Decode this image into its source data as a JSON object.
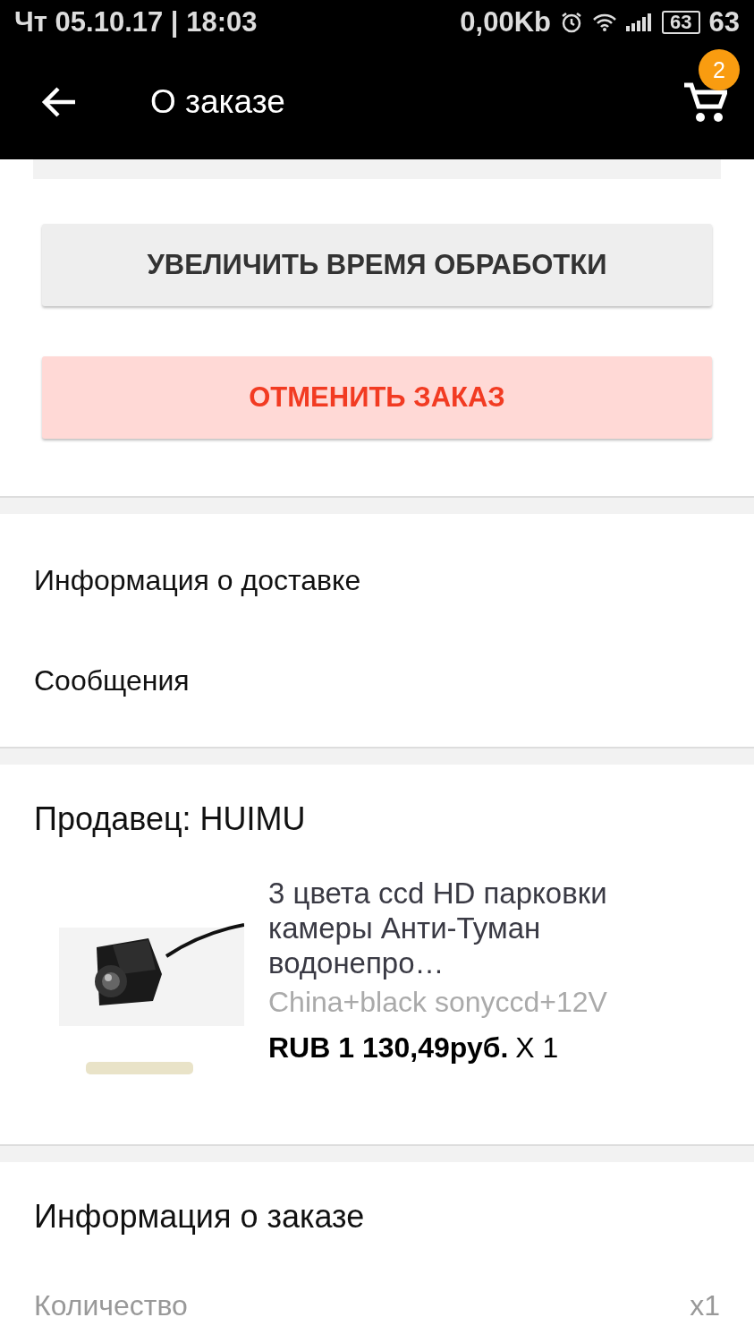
{
  "status_bar": {
    "datetime": "Чт 05.10.17 | 18:03",
    "network_speed": "0,00Kb",
    "battery_icon_text": "63",
    "battery": "63"
  },
  "app_bar": {
    "title": "О заказе",
    "cart_badge": "2"
  },
  "buttons": [
    {
      "label": "УВЕЛИЧИТЬ ВРЕМЯ ОБРАБОТКИ",
      "kind": "neutral"
    },
    {
      "label": "ОТМЕНИТЬ ЗАКАЗ",
      "kind": "danger"
    }
  ],
  "links": [
    "Информация о доставке",
    "Сообщения"
  ],
  "seller": "Продавец: HUIMU",
  "product": {
    "title": "3 цвета ccd HD парковки камеры Анти-Туман водонепро…",
    "variant": "China+black sonyccd+12V",
    "price": "RUB 1 130,49руб.",
    "quantity": "X 1"
  },
  "order_info": {
    "title": "Информация о заказе",
    "rows": [
      {
        "label": "Количество",
        "value": "x1"
      }
    ]
  }
}
